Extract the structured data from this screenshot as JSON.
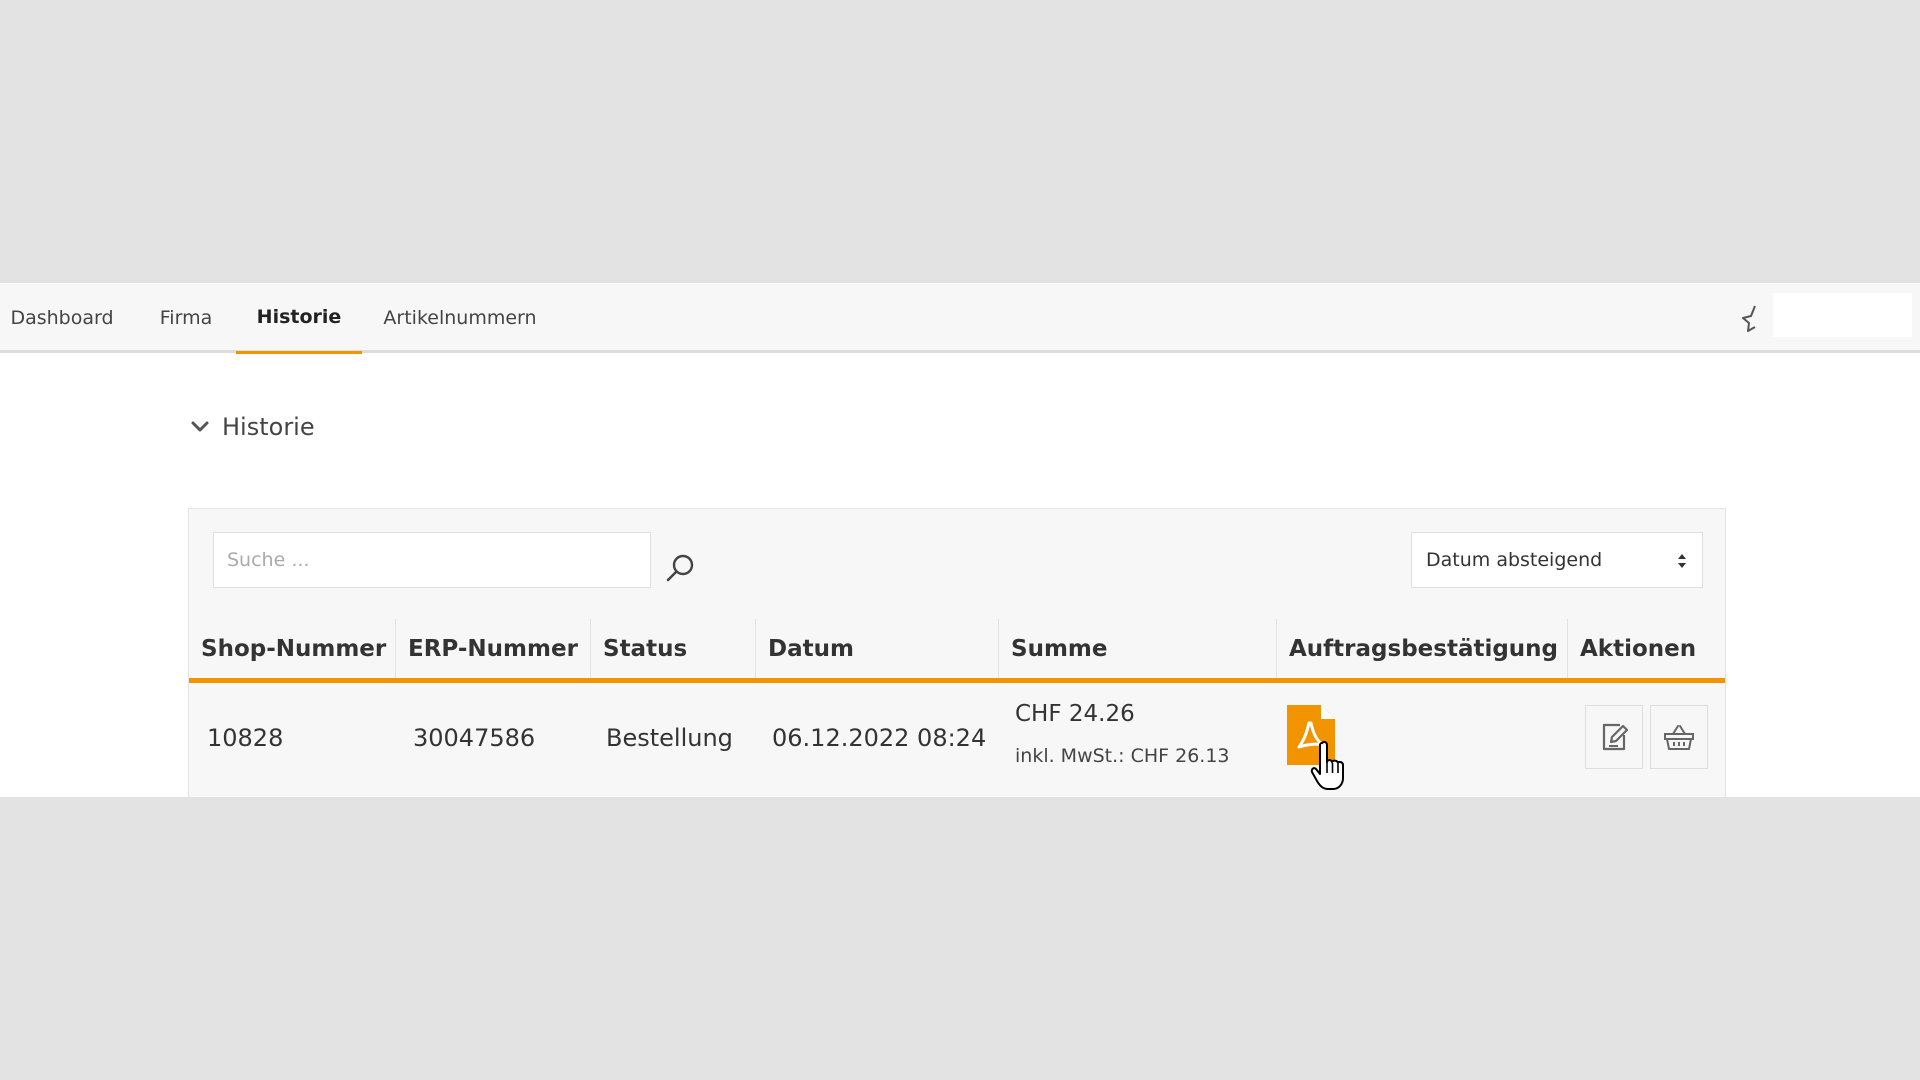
{
  "nav": {
    "tabs": [
      {
        "label": "Dashboard"
      },
      {
        "label": "Firma"
      },
      {
        "label": "Historie",
        "active": true
      },
      {
        "label": "Artikelnummern"
      }
    ],
    "favorite_icon": "star-icon"
  },
  "section": {
    "title": "Historie",
    "toggle_icon": "chevron-down-icon"
  },
  "toolbar": {
    "search_placeholder": "Suche ...",
    "search_icon": "search-icon",
    "sort_selected": "Datum absteigend"
  },
  "table": {
    "columns": [
      "Shop-Nummer",
      "ERP-Nummer",
      "Status",
      "Datum",
      "Summe",
      "Auftragsbestätigung",
      "Aktionen"
    ],
    "rows": [
      {
        "shop_number": "10828",
        "erp_number": "30047586",
        "status": "Bestellung",
        "date": "06.12.2022 08:24",
        "sum": "CHF 24.26",
        "sum_incl_vat": "inkl. MwSt.: CHF 26.13",
        "confirmation_icon": "pdf-icon",
        "actions": [
          "edit-icon",
          "basket-icon"
        ]
      }
    ]
  },
  "colors": {
    "accent": "#f29400",
    "page_background": "#e3e3e3",
    "panel_background": "#f7f7f7"
  }
}
